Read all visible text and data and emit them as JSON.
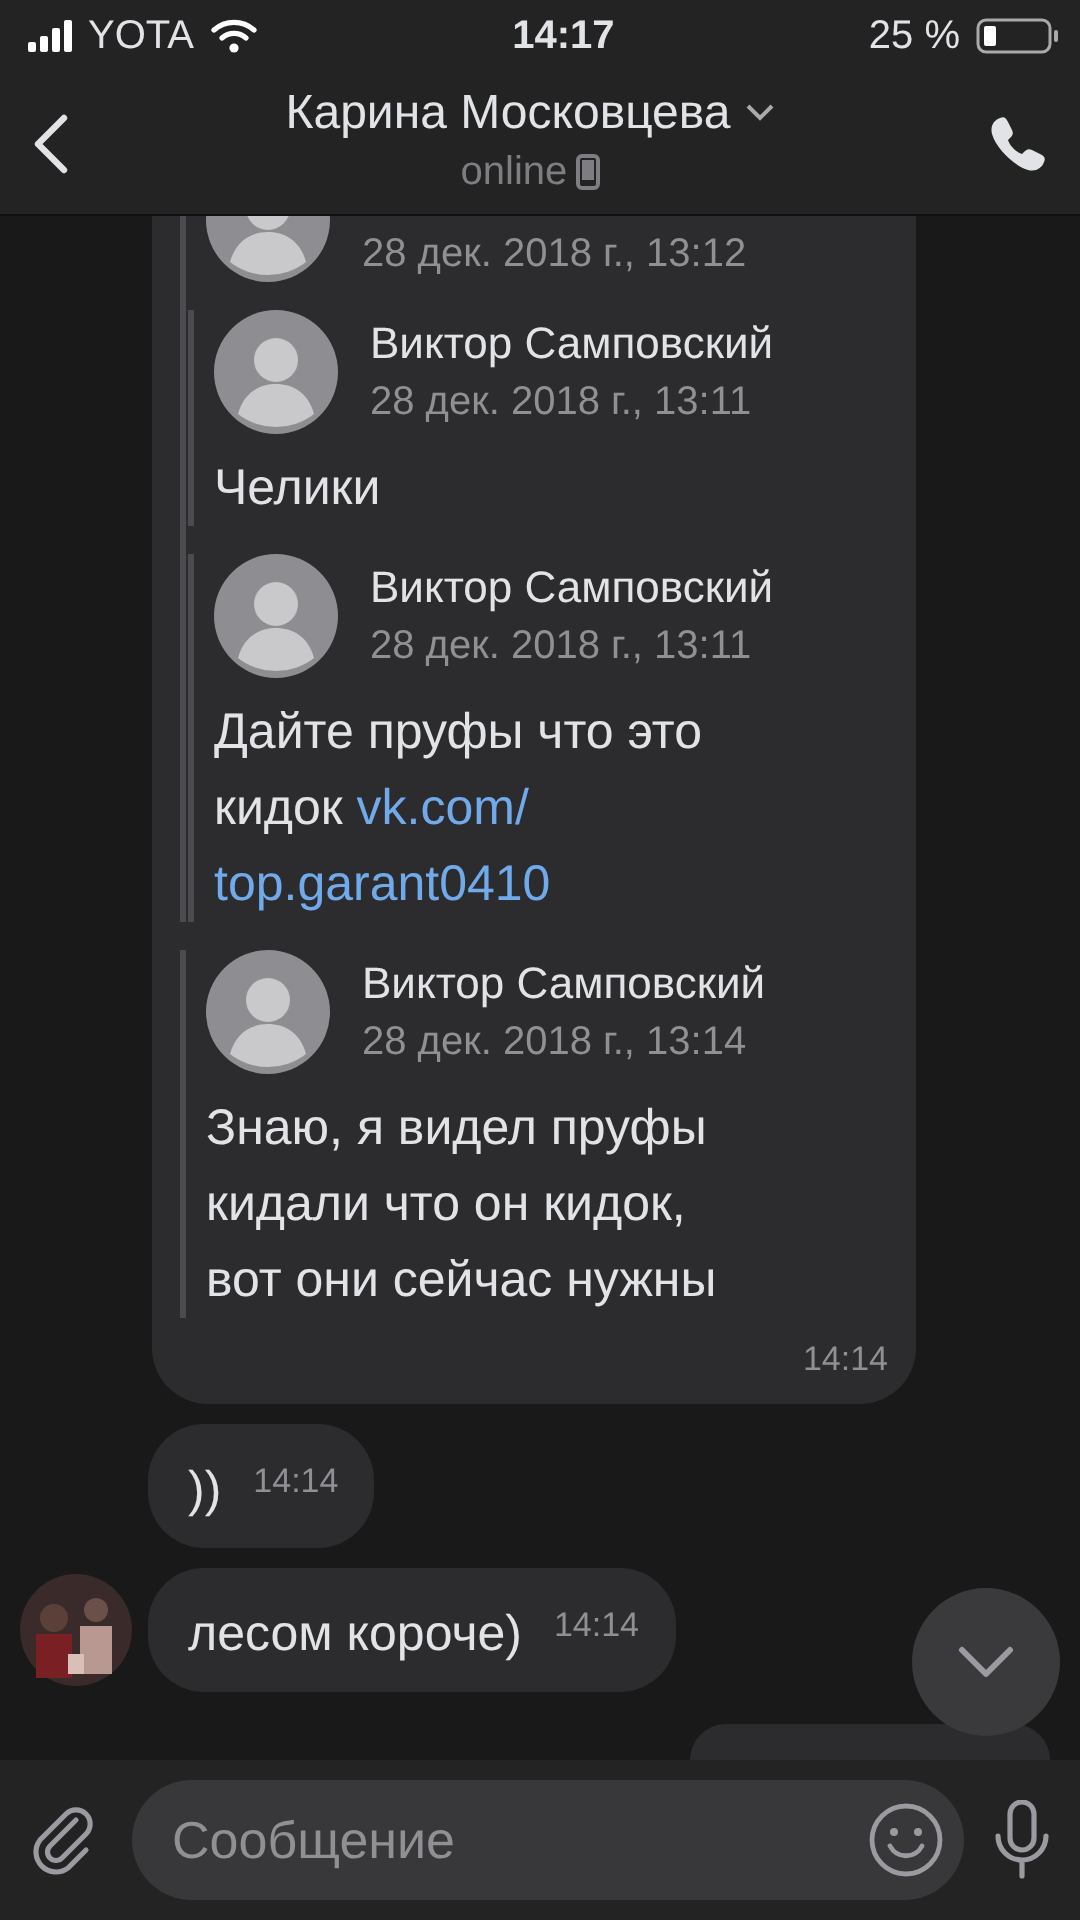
{
  "status_bar": {
    "carrier": "YOTA",
    "time": "14:17",
    "battery": "25 %"
  },
  "header": {
    "title": "Карина Московцева",
    "status": "online"
  },
  "messages": [
    {
      "kind": "forwarded",
      "time": "14:14",
      "forwards": [
        {
          "date": "28 дек. 2018 г., 13:12",
          "children": [
            {
              "author": "Виктор Самповский",
              "date": "28 дек. 2018 г., 13:11",
              "lines": [
                "Челики"
              ]
            },
            {
              "author": "Виктор Самповский",
              "date": "28 дек. 2018 г., 13:11",
              "lines": [
                "Дайте пруфы что это",
                "кидок"
              ],
              "link_parts": [
                "vk.com/",
                "top.garant0410"
              ]
            }
          ]
        },
        {
          "author": "Виктор Самповский",
          "date": "28 дек. 2018 г., 13:14",
          "lines": [
            "Знаю, я видел пруфы",
            "кидали что он кидок,",
            "вот они сейчас нужны"
          ]
        }
      ]
    },
    {
      "kind": "text",
      "text": "))",
      "time": "14:14",
      "avatar": false
    },
    {
      "kind": "text",
      "text": "лесом короче)",
      "time": "14:14",
      "avatar": true
    },
    {
      "kind": "outgoing"
    }
  ],
  "composer": {
    "placeholder": "Сообщение"
  }
}
